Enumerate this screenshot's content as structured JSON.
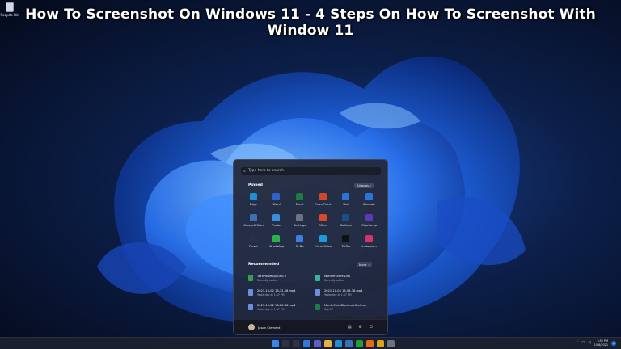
{
  "headline": "How To Screenshot On Windows 11 - 4 Steps On How To Screenshot With Window 11",
  "desktop": {
    "recycle_bin_label": "Recycle Bin"
  },
  "start_menu": {
    "search_placeholder": "Type here to search",
    "pinned_title": "Pinned",
    "all_apps_label": "All apps",
    "pinned_apps": [
      {
        "name": "Edge",
        "icon": "edge-icon",
        "color": "#1f8fd6"
      },
      {
        "name": "Word",
        "icon": "word-icon",
        "color": "#2b63c6"
      },
      {
        "name": "Excel",
        "icon": "excel-icon",
        "color": "#1f7a44"
      },
      {
        "name": "PowerPoint",
        "icon": "powerpoint-icon",
        "color": "#d2472b"
      },
      {
        "name": "Mail",
        "icon": "mail-icon",
        "color": "#2a73d9"
      },
      {
        "name": "Calendar",
        "icon": "calendar-icon",
        "color": "#2a73d9"
      },
      {
        "name": "Microsoft Store",
        "icon": "store-icon",
        "color": "#3c6fb8"
      },
      {
        "name": "Photos",
        "icon": "photos-icon",
        "color": "#3b8ed8"
      },
      {
        "name": "Settings",
        "icon": "settings-icon",
        "color": "#6c7380"
      },
      {
        "name": "Office",
        "icon": "office-icon",
        "color": "#d9482b"
      },
      {
        "name": "Solitaire",
        "icon": "solitaire-icon",
        "color": "#1c4f86"
      },
      {
        "name": "Clipchamp",
        "icon": "clipchamp-icon",
        "color": "#5a3ab5"
      },
      {
        "name": "Pinset",
        "icon": "pinset-icon",
        "color": "#2c2f45"
      },
      {
        "name": "WhatsApp",
        "icon": "whatsapp-icon",
        "color": "#2bb24c"
      },
      {
        "name": "To Do",
        "icon": "todo-icon",
        "color": "#3e7ee0"
      },
      {
        "name": "Prime Video",
        "icon": "prime-video-icon",
        "color": "#1d9bd8"
      },
      {
        "name": "TikTok",
        "icon": "tiktok-icon",
        "color": "#111111"
      },
      {
        "name": "Instagram",
        "icon": "instagram-icon",
        "color": "#d6336c"
      }
    ],
    "recommended_title": "Recommended",
    "more_label": "More",
    "recommended": [
      {
        "title": "TechPowerUp GPU-Z",
        "subtitle": "Recently added",
        "icon": "gpu-z-icon",
        "color": "#3a9d4e"
      },
      {
        "title": "Wondershare DRS",
        "subtitle": "Recently added",
        "icon": "wondershare-icon",
        "color": "#37b39a"
      },
      {
        "title": "2021-10-02 13-32-58.mp4",
        "subtitle": "Yesterday at 1:47 PM",
        "icon": "video-file-icon",
        "color": "#6b8fd8"
      },
      {
        "title": "2021-10-05 15-08-38.mp4",
        "subtitle": "Yesterday at 1:47 PM",
        "icon": "video-file-icon",
        "color": "#6b8fd8"
      },
      {
        "title": "2021-10-02 13-26-38.mp4",
        "subtitle": "Yesterday at 1:47 PM",
        "icon": "video-file-icon",
        "color": "#6b8fd8"
      },
      {
        "title": "MonteCarloBlackJackSimPro...",
        "subtitle": "Sep 27",
        "icon": "excel-file-icon",
        "color": "#1f7a44"
      }
    ],
    "user_name": "Jason Clement"
  },
  "taskbar": {
    "icons": [
      {
        "icon": "windows-start-icon",
        "color": "#3a86e8"
      },
      {
        "icon": "search-icon",
        "color": "#2d3244"
      },
      {
        "icon": "task-view-icon",
        "color": "#2d3244"
      },
      {
        "icon": "widgets-icon",
        "color": "#2e7bd6"
      },
      {
        "icon": "teams-chat-icon",
        "color": "#5b5fc7"
      },
      {
        "icon": "file-explorer-icon",
        "color": "#e3b341"
      },
      {
        "icon": "edge-icon",
        "color": "#1f8fd6"
      },
      {
        "icon": "store-icon",
        "color": "#3c6fb8"
      },
      {
        "icon": "xbox-icon",
        "color": "#1f9e3a"
      },
      {
        "icon": "firefox-icon",
        "color": "#e06a1d"
      },
      {
        "icon": "chrome-icon",
        "color": "#d9a41a"
      },
      {
        "icon": "settings-icon",
        "color": "#6c7380"
      }
    ],
    "clock_time": "3:52 PM",
    "clock_date": "10/6/2021",
    "notification_count": "1"
  }
}
